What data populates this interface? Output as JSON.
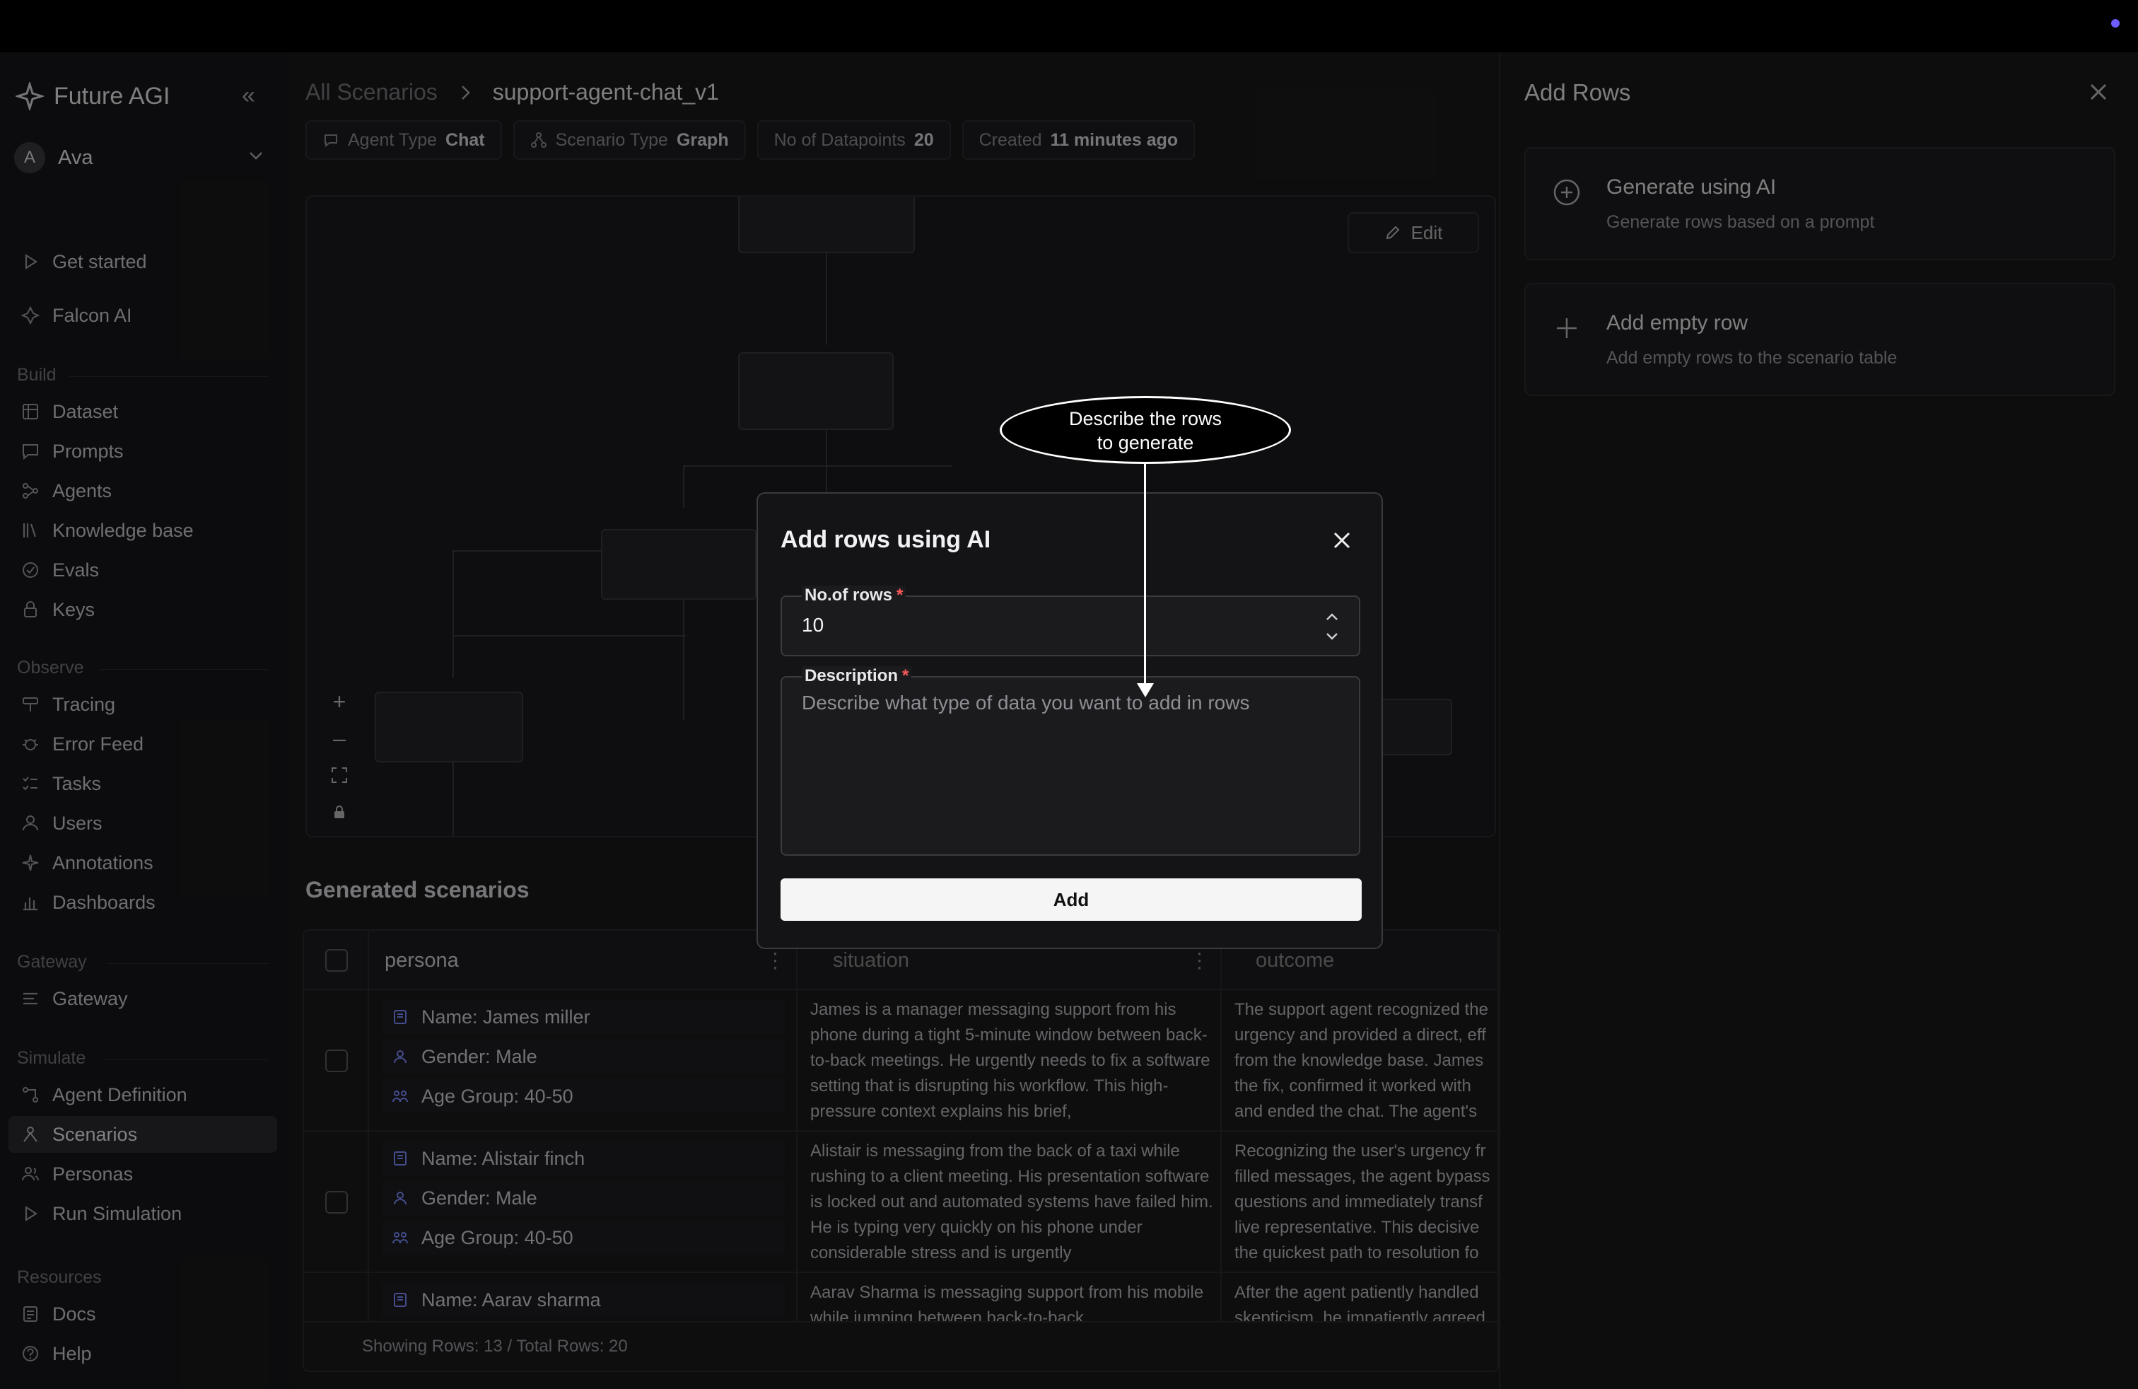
{
  "brand": {
    "name": "Future AGI"
  },
  "user": {
    "initial": "A",
    "name": "Ava"
  },
  "nav": {
    "top": [
      {
        "label": "Get started",
        "icon": "play-icon"
      },
      {
        "label": "Falcon AI",
        "icon": "falcon-icon"
      }
    ],
    "build_label": "Build",
    "build": [
      {
        "label": "Dataset"
      },
      {
        "label": "Prompts"
      },
      {
        "label": "Agents"
      },
      {
        "label": "Knowledge base"
      },
      {
        "label": "Evals"
      },
      {
        "label": "Keys"
      }
    ],
    "observe_label": "Observe",
    "observe": [
      {
        "label": "Tracing"
      },
      {
        "label": "Error Feed"
      },
      {
        "label": "Tasks"
      },
      {
        "label": "Users"
      },
      {
        "label": "Annotations"
      },
      {
        "label": "Dashboards"
      }
    ],
    "gateway_label": "Gateway",
    "gateway": [
      {
        "label": "Gateway"
      }
    ],
    "simulate_label": "Simulate",
    "simulate": [
      {
        "label": "Agent Definition"
      },
      {
        "label": "Scenarios",
        "active": true
      },
      {
        "label": "Personas"
      },
      {
        "label": "Run Simulation"
      }
    ],
    "resources_label": "Resources",
    "resources": [
      {
        "label": "Docs"
      },
      {
        "label": "Help"
      }
    ]
  },
  "breadcrumb": {
    "parent": "All Scenarios",
    "current": "support-agent-chat_v1"
  },
  "chips": [
    {
      "key": "Agent Type",
      "value": "Chat"
    },
    {
      "key": "Scenario Type",
      "value": "Graph"
    },
    {
      "key": "No of Datapoints",
      "value": "20"
    },
    {
      "key": "Created",
      "value": "11 minutes ago"
    }
  ],
  "graph": {
    "edit_label": "Edit"
  },
  "generated": {
    "title": "Generated scenarios",
    "columns": [
      "persona",
      "situation",
      "outcome"
    ],
    "rows": [
      {
        "name": "Name: James miller",
        "gender": "Gender: Male",
        "age": "Age Group: 40-50",
        "situation": "James is a manager messaging support from his phone during a tight 5-minute window between back-to-back meetings. He urgently needs to fix a software setting that is disrupting his workflow. This high-pressure context explains his brief,",
        "outcome": "The support agent recognized the urgency and provided a direct, eff from the knowledge base. James the fix, confirmed it worked with and ended the chat. The agent's"
      },
      {
        "name": "Name: Alistair finch",
        "gender": "Gender: Male",
        "age": "Age Group: 40-50",
        "situation": "Alistair is messaging from the back of a taxi while rushing to a client meeting. His presentation software is locked out and automated systems have failed him. He is typing very quickly on his phone under considerable stress and is urgently",
        "outcome": "Recognizing the user's urgency fr filled messages, the agent bypass questions and immediately transf live representative. This decisive the quickest path to resolution fo"
      },
      {
        "name": "Name: Aarav sharma",
        "situation": "Aarav Sharma is messaging support from his mobile while jumping between back-to-back",
        "outcome": "After the agent patiently handled skepticism, he impatiently agreed"
      }
    ],
    "footer": "Showing Rows: 13 / Total Rows: 20"
  },
  "drawer": {
    "title": "Add Rows",
    "options": [
      {
        "title": "Generate using AI",
        "desc": "Generate rows based on a prompt"
      },
      {
        "title": "Add empty row",
        "desc": "Add empty rows to the scenario table"
      }
    ]
  },
  "modal": {
    "title": "Add rows using AI",
    "rows_label": "No.of rows",
    "rows_value": "10",
    "desc_label": "Description",
    "desc_placeholder": "Describe what type of data you want to add in rows",
    "add_label": "Add"
  },
  "callout": {
    "line1": "Describe the rows",
    "line2": "to generate"
  },
  "colors": {
    "accent": "#6d5cff",
    "required": "#ff5a5a",
    "background": "#19191b"
  }
}
